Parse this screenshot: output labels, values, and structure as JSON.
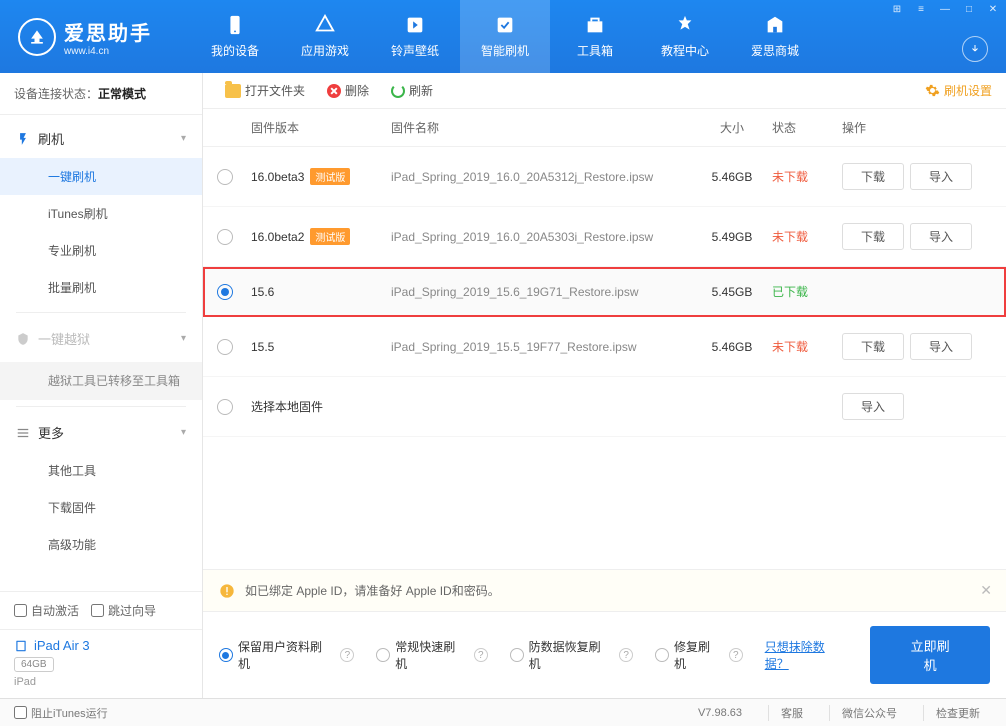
{
  "logo": {
    "title": "爱思助手",
    "sub": "www.i4.cn"
  },
  "nav": [
    {
      "label": "我的设备"
    },
    {
      "label": "应用游戏"
    },
    {
      "label": "铃声壁纸"
    },
    {
      "label": "智能刷机"
    },
    {
      "label": "工具箱"
    },
    {
      "label": "教程中心"
    },
    {
      "label": "爱思商城"
    }
  ],
  "conn": {
    "prefix": "设备连接状态：",
    "mode": "正常模式"
  },
  "side": {
    "flash": "刷机",
    "items": [
      "一键刷机",
      "iTunes刷机",
      "专业刷机",
      "批量刷机"
    ],
    "jailbreak": "一键越狱",
    "jailbreak_note": "越狱工具已转移至工具箱",
    "more": "更多",
    "more_items": [
      "其他工具",
      "下载固件",
      "高级功能"
    ],
    "auto_activate": "自动激活",
    "skip_guide": "跳过向导"
  },
  "device": {
    "name": "iPad Air 3",
    "cap": "64GB",
    "type": "iPad"
  },
  "toolbar": {
    "open": "打开文件夹",
    "del": "删除",
    "refresh": "刷新",
    "settings": "刷机设置"
  },
  "table": {
    "cols": {
      "ver": "固件版本",
      "name": "固件名称",
      "size": "大小",
      "stat": "状态",
      "ops": "操作"
    },
    "ops": {
      "download": "下载",
      "import": "导入"
    },
    "rows": [
      {
        "ver": "16.0beta3",
        "beta": "测试版",
        "name": "iPad_Spring_2019_16.0_20A5312j_Restore.ipsw",
        "size": "5.46GB",
        "stat": "未下载",
        "stat_cls": "stat-no",
        "sel": false,
        "hl": false,
        "ops": true
      },
      {
        "ver": "16.0beta2",
        "beta": "测试版",
        "name": "iPad_Spring_2019_16.0_20A5303i_Restore.ipsw",
        "size": "5.49GB",
        "stat": "未下载",
        "stat_cls": "stat-no",
        "sel": false,
        "hl": false,
        "ops": true
      },
      {
        "ver": "15.6",
        "beta": "",
        "name": "iPad_Spring_2019_15.6_19G71_Restore.ipsw",
        "size": "5.45GB",
        "stat": "已下载",
        "stat_cls": "stat-yes",
        "sel": true,
        "hl": true,
        "ops": false
      },
      {
        "ver": "15.5",
        "beta": "",
        "name": "iPad_Spring_2019_15.5_19F77_Restore.ipsw",
        "size": "5.46GB",
        "stat": "未下载",
        "stat_cls": "stat-no",
        "sel": false,
        "hl": false,
        "ops": true
      }
    ],
    "local": "选择本地固件"
  },
  "banner": {
    "text": "如已绑定 Apple ID，请准备好 Apple ID和密码。"
  },
  "options": {
    "items": [
      "保留用户资料刷机",
      "常规快速刷机",
      "防数据恢复刷机",
      "修复刷机"
    ],
    "link": "只想抹除数据？",
    "flash": "立即刷机"
  },
  "footer": {
    "block": "阻止iTunes运行",
    "ver": "V7.98.63",
    "svc": "客服",
    "wechat": "微信公众号",
    "update": "检查更新"
  }
}
